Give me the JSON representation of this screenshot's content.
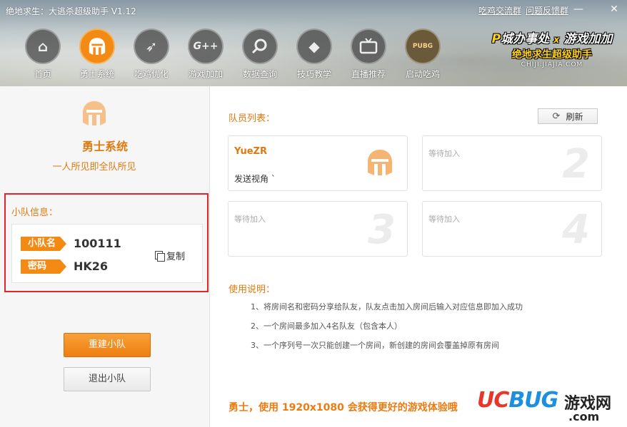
{
  "app": {
    "title": "绝地求生：大逃杀超级助手 V1.12"
  },
  "top_links": [
    "吃鸡交流群",
    "问题反馈群"
  ],
  "window_controls": {
    "minimize": "—",
    "close": "✕"
  },
  "nav": [
    {
      "label": "首页",
      "icon": "home-icon",
      "glyph": "⌂"
    },
    {
      "label": "勇士系统",
      "icon": "helmet-icon",
      "glyph": ""
    },
    {
      "label": "吃鸡优化",
      "icon": "rocket-icon",
      "glyph": "➶"
    },
    {
      "label": "游戏加加",
      "icon": "gplus-icon",
      "glyph": "G++"
    },
    {
      "label": "数据查询",
      "icon": "search-icon",
      "glyph": "⚲"
    },
    {
      "label": "技巧教学",
      "icon": "diamond-icon",
      "glyph": "◆"
    },
    {
      "label": "直播推荐",
      "icon": "tv-icon",
      "glyph": "▭"
    },
    {
      "label": "启动吃鸡",
      "icon": "pubg-logo-icon",
      "glyph": "PUBG"
    }
  ],
  "nav_active_index": 1,
  "brand": {
    "line1_p": "P",
    "line1_a": "城办事处",
    "line1_x": "x",
    "line1_b": "游戏加加",
    "line2": "绝地求生超级助手",
    "line3": "CHIJI.JIAJIA.COM"
  },
  "left": {
    "title": "勇士系统",
    "subtitle": "一人所见即全队所见",
    "team_info_label": "小队信息：",
    "team_name_tag": "小队名",
    "team_name": "100111",
    "password_tag": "密码",
    "password": "HK26",
    "copy_label": "复制",
    "rebuild_label": "重建小队",
    "exit_label": "退出小队"
  },
  "right": {
    "members_title": "队员列表：",
    "refresh_label": "刷新",
    "members": [
      {
        "name": "YueZR",
        "sub": "发送视角 `",
        "slot": "1",
        "waiting": false
      },
      {
        "name": "等待加入",
        "slot": "2",
        "waiting": true
      },
      {
        "name": "等待加入",
        "slot": "3",
        "waiting": true
      },
      {
        "name": "等待加入",
        "slot": "4",
        "waiting": true
      }
    ],
    "usage_title": "使用说明：",
    "usage": [
      "1、将房间名和密码分享给队友，队友点击加入房间后输入对应信息即加入成功",
      "2、一个房间最多加入4名队友（包含本人）",
      "3、一个序列号一次只能创建一个房间，新创建的房间会覆盖掉原有房间"
    ],
    "tip": "勇士，使用 1920x1080 会获得更好的游戏体验哦"
  },
  "watermark": {
    "uc": "UC",
    "bug": "BUG",
    "game": "游戏网",
    "com": ".com"
  },
  "colors": {
    "accent": "#f28a14",
    "highlight_border": "#e0262a"
  }
}
